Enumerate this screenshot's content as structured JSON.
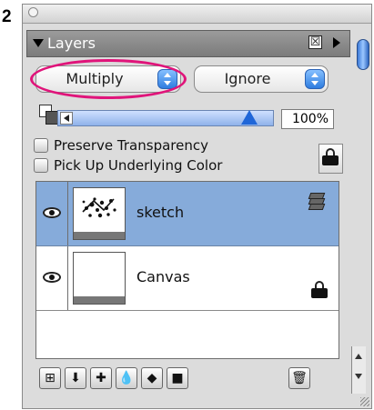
{
  "figure": {
    "step_number": "2"
  },
  "panel": {
    "title": "Layers",
    "close_symbol": "☒",
    "blend_mode": "Multiply",
    "composite_mode": "Ignore",
    "opacity_text": "100%",
    "opacity_level": 0.92,
    "options": [
      {
        "label": "Preserve Transparency",
        "checked": false
      },
      {
        "label": "Pick Up Underlying Color",
        "checked": false
      }
    ],
    "layers": [
      {
        "name": "sketch",
        "visible": true,
        "selected": true,
        "icon": "layer-stack-icon"
      },
      {
        "name": "Canvas",
        "visible": true,
        "selected": false,
        "icon": "lock-icon"
      }
    ],
    "toolbar": [
      {
        "icon": "layer-options-icon",
        "glyph": "⊞"
      },
      {
        "icon": "drop-layer-icon",
        "glyph": "⬇"
      },
      {
        "icon": "new-layer-icon",
        "glyph": "✚"
      },
      {
        "icon": "water-drop-icon",
        "glyph": "💧"
      },
      {
        "icon": "mask-icon",
        "glyph": "◆"
      },
      {
        "icon": "fill-icon",
        "glyph": "■"
      },
      {
        "icon": "trash-icon",
        "glyph": "🗑"
      }
    ]
  }
}
